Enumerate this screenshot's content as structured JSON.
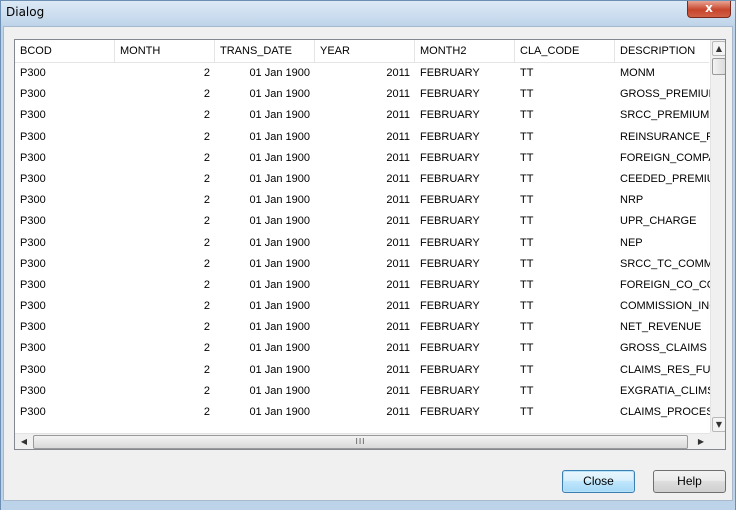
{
  "window": {
    "title": "Dialog",
    "close_glyph": "x"
  },
  "grid": {
    "columns": [
      "BCOD",
      "MONTH",
      "TRANS_DATE",
      "YEAR",
      "MONTH2",
      "CLA_CODE",
      "DESCRIPTION"
    ],
    "rows": [
      [
        "P300",
        "2",
        "01 Jan 1900",
        "2011",
        "FEBRUARY",
        "TT",
        "MONM"
      ],
      [
        "P300",
        "2",
        "01 Jan 1900",
        "2011",
        "FEBRUARY",
        "TT",
        "GROSS_PREMIUM"
      ],
      [
        "P300",
        "2",
        "01 Jan 1900",
        "2011",
        "FEBRUARY",
        "TT",
        "SRCC_PREMIUM"
      ],
      [
        "P300",
        "2",
        "01 Jan 1900",
        "2011",
        "FEBRUARY",
        "TT",
        "REINSURANCE_FU"
      ],
      [
        "P300",
        "2",
        "01 Jan 1900",
        "2011",
        "FEBRUARY",
        "TT",
        "FOREIGN_COMPAN"
      ],
      [
        "P300",
        "2",
        "01 Jan 1900",
        "2011",
        "FEBRUARY",
        "TT",
        "CEEDED_PREMIUM"
      ],
      [
        "P300",
        "2",
        "01 Jan 1900",
        "2011",
        "FEBRUARY",
        "TT",
        "NRP"
      ],
      [
        "P300",
        "2",
        "01 Jan 1900",
        "2011",
        "FEBRUARY",
        "TT",
        "UPR_CHARGE"
      ],
      [
        "P300",
        "2",
        "01 Jan 1900",
        "2011",
        "FEBRUARY",
        "TT",
        "NEP"
      ],
      [
        "P300",
        "2",
        "01 Jan 1900",
        "2011",
        "FEBRUARY",
        "TT",
        "SRCC_TC_COMMIS"
      ],
      [
        "P300",
        "2",
        "01 Jan 1900",
        "2011",
        "FEBRUARY",
        "TT",
        "FOREIGN_CO_COM"
      ],
      [
        "P300",
        "2",
        "01 Jan 1900",
        "2011",
        "FEBRUARY",
        "TT",
        "COMMISSION_INC"
      ],
      [
        "P300",
        "2",
        "01 Jan 1900",
        "2011",
        "FEBRUARY",
        "TT",
        "NET_REVENUE"
      ],
      [
        "P300",
        "2",
        "01 Jan 1900",
        "2011",
        "FEBRUARY",
        "TT",
        "GROSS_CLAIMS"
      ],
      [
        "P300",
        "2",
        "01 Jan 1900",
        "2011",
        "FEBRUARY",
        "TT",
        "CLAIMS_RES_FUND"
      ],
      [
        "P300",
        "2",
        "01 Jan 1900",
        "2011",
        "FEBRUARY",
        "TT",
        "EXGRATIA_CLIMS_"
      ],
      [
        "P300",
        "2",
        "01 Jan 1900",
        "2011",
        "FEBRUARY",
        "TT",
        "CLAIMS_PROCESSI"
      ]
    ],
    "hscroll_grip": "III"
  },
  "buttons": {
    "close": "Close",
    "help": "Help"
  },
  "icons": {
    "scroll_up": "▲",
    "scroll_down": "▼",
    "scroll_left": "◀",
    "scroll_right": "▶"
  }
}
